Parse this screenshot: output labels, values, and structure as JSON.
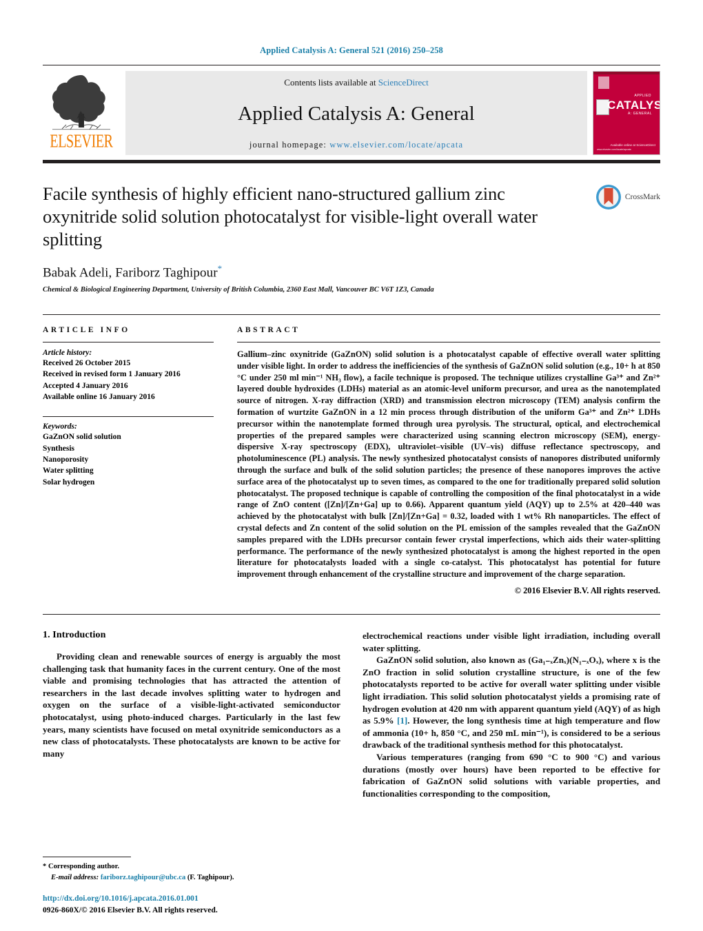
{
  "running_head": "Applied Catalysis A: General 521 (2016) 250–258",
  "masthead": {
    "contents_prefix": "Contents lists available at ",
    "sciencedirect": "ScienceDirect",
    "journal_title": "Applied Catalysis A: General",
    "homepage_prefix": "journal homepage: ",
    "homepage_url": "www.elsevier.com/locate/apcata",
    "publisher_wordmark": "ELSEVIER",
    "cover": {
      "title": "CATALYSIS",
      "superscript": "APPLIED",
      "subscript": "A: GENERAL",
      "footer": "Available online at\nScienceDirect",
      "footer_left": "www.elsevier.com/locate/apcata"
    }
  },
  "article": {
    "title": "Facile synthesis of highly efficient nano-structured gallium zinc oxynitride solid solution photocatalyst for visible-light overall water splitting",
    "authors": "Babak Adeli, Fariborz Taghipour",
    "corresponding_marker": "*",
    "affiliation": "Chemical & Biological Engineering Department, University of British Columbia, 2360 East Mall, Vancouver BC V6T 1Z3, Canada",
    "crossmark_label": "CrossMark"
  },
  "article_info": {
    "heading": "ARTICLE INFO",
    "history_label": "Article history:",
    "history": [
      "Received 26 October 2015",
      "Received in revised form 1 January 2016",
      "Accepted 4 January 2016",
      "Available online 16 January 2016"
    ],
    "keywords_label": "Keywords:",
    "keywords": [
      "GaZnON solid solution",
      "Synthesis",
      "Nanoporosity",
      "Water splitting",
      "Solar hydrogen"
    ]
  },
  "abstract": {
    "heading": "ABSTRACT",
    "text": "Gallium–zinc oxynitride (GaZnON) solid solution is a photocatalyst capable of effective overall water splitting under visible light. In order to address the inefficiencies of the synthesis of GaZnON solid solution (e.g., 10+ h at 850 °C under 250 ml min⁻¹ NH₃ flow), a facile technique is proposed. The technique utilizes crystalline Ga³⁺ and Zn²⁺ layered double hydroxides (LDHs) material as an atomic-level uniform precursor, and urea as the nanotemplated source of nitrogen. X-ray diffraction (XRD) and transmission electron microscopy (TEM) analysis confirm the formation of wurtzite GaZnON in a 12 min process through distribution of the uniform Ga³⁺ and Zn²⁺ LDHs precursor within the nanotemplate formed through urea pyrolysis. The structural, optical, and electrochemical properties of the prepared samples were characterized using scanning electron microscopy (SEM), energy-dispersive X-ray spectroscopy (EDX), ultraviolet–visible (UV–vis) diffuse reflectance spectroscopy, and photoluminescence (PL) analysis. The newly synthesized photocatalyst consists of nanopores distributed uniformly through the surface and bulk of the solid solution particles; the presence of these nanopores improves the active surface area of the photocatalyst up to seven times, as compared to the one for traditionally prepared solid solution photocatalyst. The proposed technique is capable of controlling the composition of the final photocatalyst in a wide range of ZnO content ([Zn]/[Zn+Ga] up to 0.66). Apparent quantum yield (AQY) up to 2.5% at 420–440 was achieved by the photocatalyst with bulk [Zn]/[Zn+Ga] = 0.32, loaded with 1 wt% Rh nanoparticles. The effect of crystal defects and Zn content of the solid solution on the PL emission of the samples revealed that the GaZnON samples prepared with the LDHs precursor contain fewer crystal imperfections, which aids their water-splitting performance. The performance of the newly synthesized photocatalyst is among the highest reported in the open literature for photocatalysts loaded with a single co-catalyst. This photocatalyst has potential for future improvement through enhancement of the crystalline structure and improvement of the charge separation.",
    "copyright": "© 2016 Elsevier B.V. All rights reserved."
  },
  "body": {
    "section_title": "1. Introduction",
    "left_paragraphs": [
      "Providing clean and renewable sources of energy is arguably the most challenging task that humanity faces in the current century. One of the most viable and promising technologies that has attracted the attention of researchers in the last decade involves splitting water to hydrogen and oxygen on the surface of a visible-light-activated semiconductor photocatalyst, using photo-induced charges. Particularly in the last few years, many scientists have focused on metal oxynitride semiconductors as a new class of photocatalysts. These photocatalysts are known to be active for many"
    ],
    "right_paragraphs": [
      {
        "indent": false,
        "text": "electrochemical reactions under visible light irradiation, including overall water splitting."
      },
      {
        "indent": true,
        "text": "GaZnON solid solution, also known as (Ga₁₋ₓZnₓ)(N₁₋ₓOₓ), where x is the ZnO fraction in solid solution crystalline structure, is one of the few photocatalysts reported to be active for overall water splitting under visible light irradiation. This solid solution photocatalyst yields a promising rate of hydrogen evolution at 420 nm with apparent quantum yield (AQY) of as high as 5.9% ",
        "ref": "[1]",
        "tail": ". However, the long synthesis time at high temperature and flow of ammonia (10+ h, 850 °C, and 250 mL min⁻¹), is considered to be a serious drawback of the traditional synthesis method for this photocatalyst."
      },
      {
        "indent": true,
        "text": "Various temperatures (ranging from 690 °C to 900 °C) and various durations (mostly over hours) have been reported to be effective for fabrication of GaZnON solid solutions with variable properties, and functionalities corresponding to the composition,"
      }
    ]
  },
  "footnote": {
    "marker": "*",
    "corresponding": "Corresponding author.",
    "email_label": "E-mail address:",
    "email": "fariborz.taghipour@ubc.ca",
    "email_suffix": "(F. Taghipour)."
  },
  "doi": {
    "url": "http://dx.doi.org/10.1016/j.apcata.2016.01.001",
    "issn_line": "0926-860X/© 2016 Elsevier B.V. All rights reserved."
  },
  "colors": {
    "link": "#1a7fa8",
    "elsevier_orange": "#F07C00",
    "cover_red": "#c2003b"
  }
}
